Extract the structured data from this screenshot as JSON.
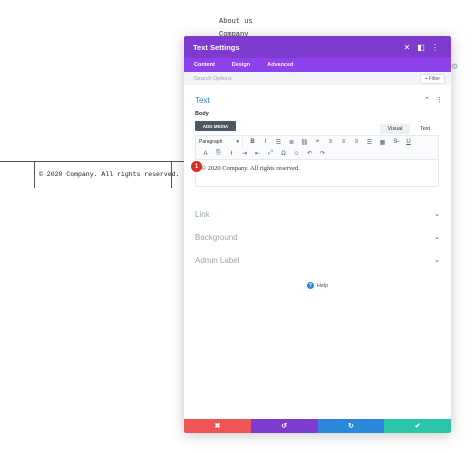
{
  "background_page": {
    "nav_about": "About us",
    "nav_company": "Company",
    "footer_copyright": "© 2020 Company. All rights reserved."
  },
  "modal": {
    "title": "Text Settings",
    "header_icons": [
      "close-icon",
      "expand-icon",
      "more-icon"
    ],
    "tabs": [
      {
        "label": "Content",
        "active": true
      },
      {
        "label": "Design",
        "active": false
      },
      {
        "label": "Advanced",
        "active": false
      }
    ],
    "search_placeholder": "Search Options",
    "filter_label": "+ Filter",
    "text_section": {
      "title": "Text",
      "body_label": "Body",
      "add_media_label": "ADD MEDIA",
      "editor_tabs": [
        "Visual",
        "Text"
      ],
      "format_select_value": "Paragraph",
      "editor_content": "© 2020 Company. All rights reserved.",
      "badge_number": "1"
    },
    "collapsed_sections": [
      "Link",
      "Background",
      "Admin Label"
    ],
    "help_label": "Help"
  },
  "colors": {
    "header": "#7e3bd0",
    "tabs_bar": "#8f42ec",
    "accent_blue": "#2b87da",
    "cancel": "#ef5555",
    "save": "#29c4a9",
    "badge": "#d62e1f"
  }
}
